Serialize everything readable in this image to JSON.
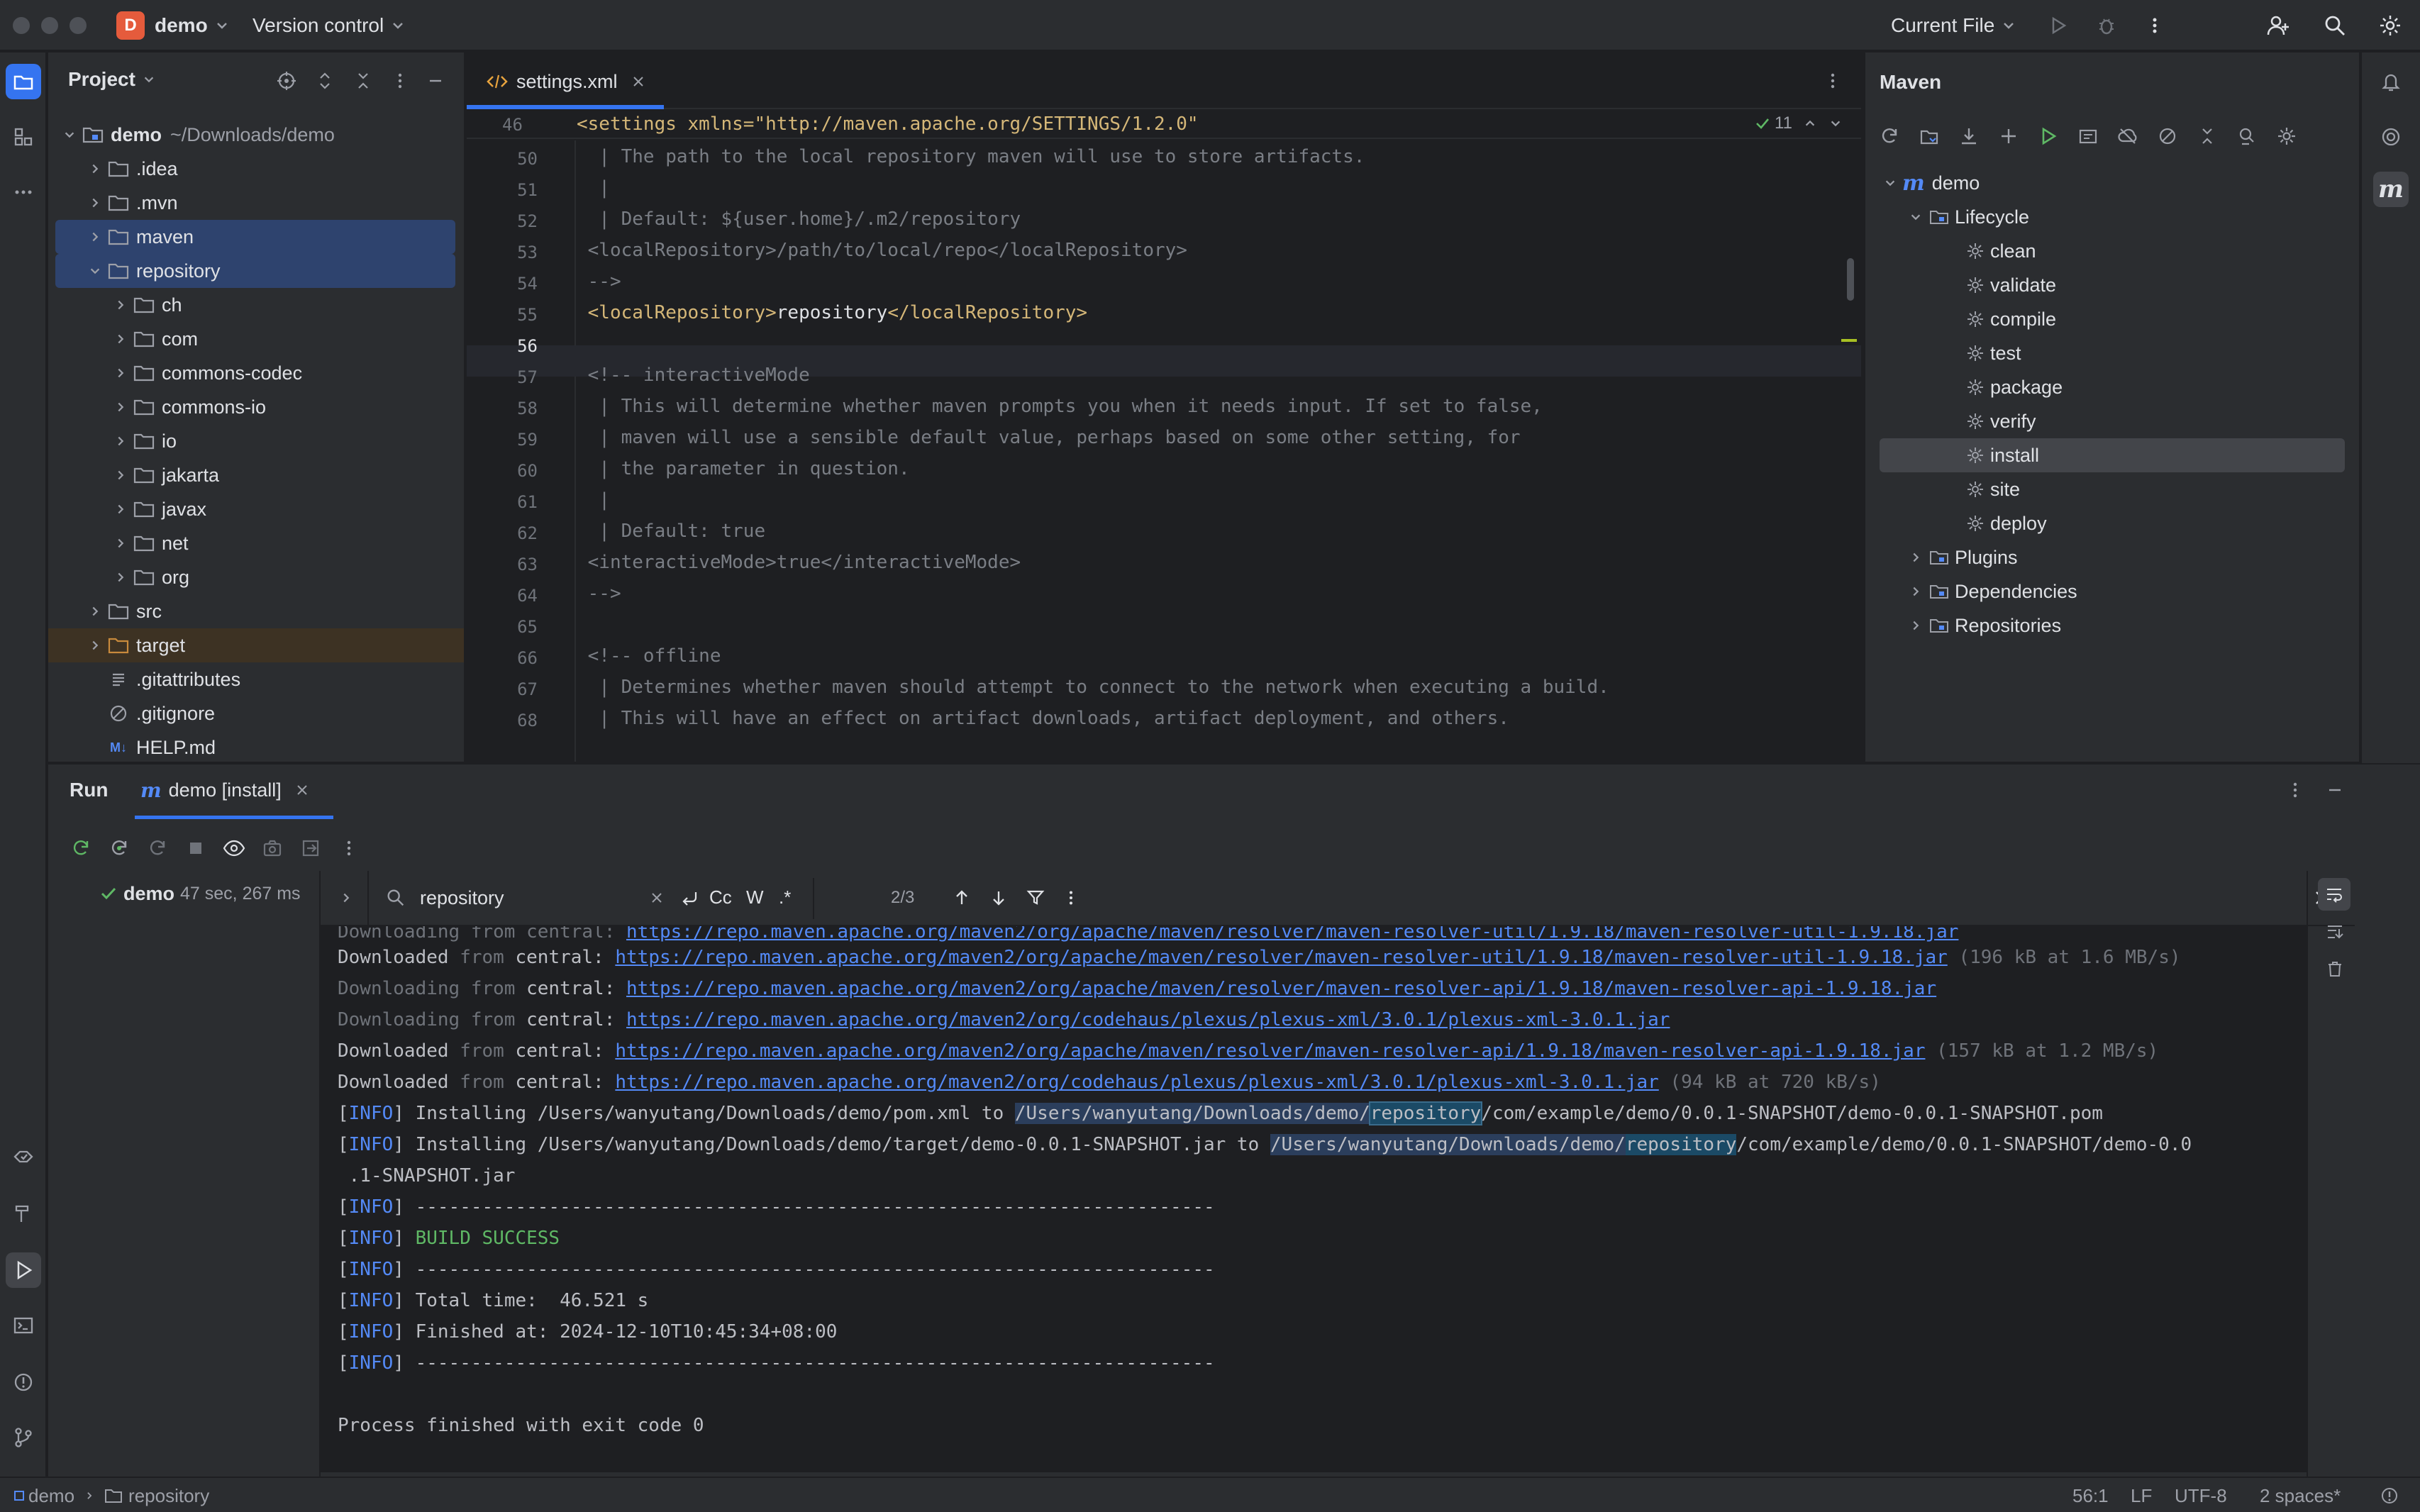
{
  "titlebar": {
    "project_badge": "D",
    "project_name": "demo",
    "vcs_label": "Version control",
    "run_config": "Current File"
  },
  "project_panel": {
    "title": "Project",
    "tree": [
      {
        "label": "demo",
        "path": "~/Downloads/demo",
        "depth": 0,
        "expanded": true,
        "type": "module"
      },
      {
        "label": ".idea",
        "depth": 1,
        "expanded": false,
        "type": "folder"
      },
      {
        "label": ".mvn",
        "depth": 1,
        "expanded": false,
        "type": "folder"
      },
      {
        "label": "maven",
        "depth": 1,
        "expanded": false,
        "type": "folder",
        "selected": true
      },
      {
        "label": "repository",
        "depth": 1,
        "expanded": true,
        "type": "folder",
        "selected": true
      },
      {
        "label": "ch",
        "depth": 2,
        "expanded": false,
        "type": "folder"
      },
      {
        "label": "com",
        "depth": 2,
        "expanded": false,
        "type": "folder"
      },
      {
        "label": "commons-codec",
        "depth": 2,
        "expanded": false,
        "type": "folder"
      },
      {
        "label": "commons-io",
        "depth": 2,
        "expanded": false,
        "type": "folder"
      },
      {
        "label": "io",
        "depth": 2,
        "expanded": false,
        "type": "folder"
      },
      {
        "label": "jakarta",
        "depth": 2,
        "expanded": false,
        "type": "folder"
      },
      {
        "label": "javax",
        "depth": 2,
        "expanded": false,
        "type": "folder"
      },
      {
        "label": "net",
        "depth": 2,
        "expanded": false,
        "type": "folder"
      },
      {
        "label": "org",
        "depth": 2,
        "expanded": false,
        "type": "folder"
      },
      {
        "label": "src",
        "depth": 1,
        "expanded": false,
        "type": "folder"
      },
      {
        "label": "target",
        "depth": 1,
        "expanded": false,
        "type": "folder-excluded"
      },
      {
        "label": ".gitattributes",
        "depth": 1,
        "type": "file-text"
      },
      {
        "label": ".gitignore",
        "depth": 1,
        "type": "file-ignore"
      },
      {
        "label": "HELP.md",
        "depth": 1,
        "type": "file-md"
      }
    ]
  },
  "editor": {
    "tab_label": "settings.xml",
    "sticky_header": "<settings xmlns=\"http://maven.apache.org/SETTINGS/1.2.0\"",
    "inspection_count": "11",
    "lines": [
      {
        "n": "50",
        "text": "  | The path to the local repository maven will use to store artifacts."
      },
      {
        "n": "51",
        "text": "  |"
      },
      {
        "n": "52",
        "text": "  | Default: ${user.home}/.m2/repository"
      },
      {
        "n": "53",
        "text": " <localRepository>/path/to/local/repo</localRepository>"
      },
      {
        "n": "54",
        "text": " -->"
      },
      {
        "n": "55",
        "text": " <localRepository>repository</localRepository>"
      },
      {
        "n": "56",
        "text": ""
      },
      {
        "n": "57",
        "text": " <!-- interactiveMode"
      },
      {
        "n": "58",
        "text": "  | This will determine whether maven prompts you when it needs input. If set to false,"
      },
      {
        "n": "59",
        "text": "  | maven will use a sensible default value, perhaps based on some other setting, for"
      },
      {
        "n": "60",
        "text": "  | the parameter in question."
      },
      {
        "n": "61",
        "text": "  |"
      },
      {
        "n": "62",
        "text": "  | Default: true"
      },
      {
        "n": "63",
        "text": " <interactiveMode>true</interactiveMode>"
      },
      {
        "n": "64",
        "text": " -->"
      },
      {
        "n": "65",
        "text": ""
      },
      {
        "n": "66",
        "text": " <!-- offline"
      },
      {
        "n": "67",
        "text": "  | Determines whether maven should attempt to connect to the network when executing a build."
      },
      {
        "n": "68",
        "text": "  | This will have an effect on artifact downloads, artifact deployment, and others."
      }
    ],
    "first_line_number": "46",
    "code_xml": {
      "open_tag": "<localRepository>",
      "value": "repository",
      "close_tag": "</localRepository>"
    }
  },
  "maven_panel": {
    "title": "Maven",
    "root": "demo",
    "lifecycle_label": "Lifecycle",
    "goals": [
      "clean",
      "validate",
      "compile",
      "test",
      "package",
      "verify",
      "install",
      "site",
      "deploy"
    ],
    "selected_goal": "install",
    "groups": [
      "Plugins",
      "Dependencies",
      "Repositories"
    ]
  },
  "run_panel": {
    "tab_run": "Run",
    "tab_config": "demo [install]",
    "tree_item": "demo",
    "tree_time": "47 sec, 267 ms",
    "search_value": "repository",
    "search_toggles": [
      "Cc",
      "W",
      ".*"
    ],
    "match_count": "2/3",
    "console": {
      "dl1_prefix": "Downloaded",
      "from": "from",
      "central": "central:",
      "dl1_url": "https://repo.maven.apache.org/maven2/org/apache/maven/resolver/maven-resolver-util/1.9.18/maven-resolver-util-1.9.18.jar",
      "dl1_size": "(196 kB at 1.6 MB/s)",
      "dl2_prefix": "Downloading",
      "dl2_url": "https://repo.maven.apache.org/maven2/org/apache/maven/resolver/maven-resolver-api/1.9.18/maven-resolver-api-1.9.18.jar",
      "dl3_prefix": "Downloading",
      "dl3_url": "https://repo.maven.apache.org/maven2/org/codehaus/plexus/plexus-xml/3.0.1/plexus-xml-3.0.1.jar",
      "dl4_prefix": "Downloaded",
      "dl4_url": "https://repo.maven.apache.org/maven2/org/apache/maven/resolver/maven-resolver-api/1.9.18/maven-resolver-api-1.9.18.jar",
      "dl4_size": "(157 kB at 1.2 MB/s)",
      "dl5_prefix": "Downloaded",
      "dl5_url": "https://repo.maven.apache.org/maven2/org/codehaus/plexus/plexus-xml/3.0.1/plexus-xml-3.0.1.jar",
      "dl5_size": "(94 kB at 720 kB/s)",
      "info_tag": "[INFO]",
      "install1_a": " Installing /Users/wanyutang/Downloads/demo/pom.xml to ",
      "install1_path": "/Users/wanyutang/Downloads/demo/",
      "install1_match": "repository",
      "install1_rest": "/com/example/demo/0.0.1-SNAPSHOT/demo-0.0.1-SNAPSHOT.pom",
      "install2_a": " Installing /Users/wanyutang/Downloads/demo/target/demo-0.0.1-SNAPSHOT.jar to ",
      "install2_path": "/Users/wanyutang/Downloads/demo/",
      "install2_match": "repository",
      "install2_rest": "/com/example/demo/0.0.1-SNAPSHOT/demo-0.0",
      "install2_wrap": " .1-SNAPSHOT.jar",
      "separator": " ------------------------------------------------------------------------",
      "build_success": " BUILD SUCCESS",
      "total_time": " Total time:  46.521 s",
      "finished_at": " Finished at: 2024-12-10T10:45:34+08:00",
      "exit_line": "Process finished with exit code 0"
    }
  },
  "statusbar": {
    "crumb_project": "demo",
    "crumb_folder": "repository",
    "caret": "56:1",
    "line_sep": "LF",
    "encoding": "UTF-8",
    "indent": "2 spaces*"
  },
  "colors": {
    "accent": "#3574f0",
    "selection": "#2e436e",
    "success": "#5fb865",
    "link": "#548af7",
    "xml_tag": "#d5b778"
  }
}
